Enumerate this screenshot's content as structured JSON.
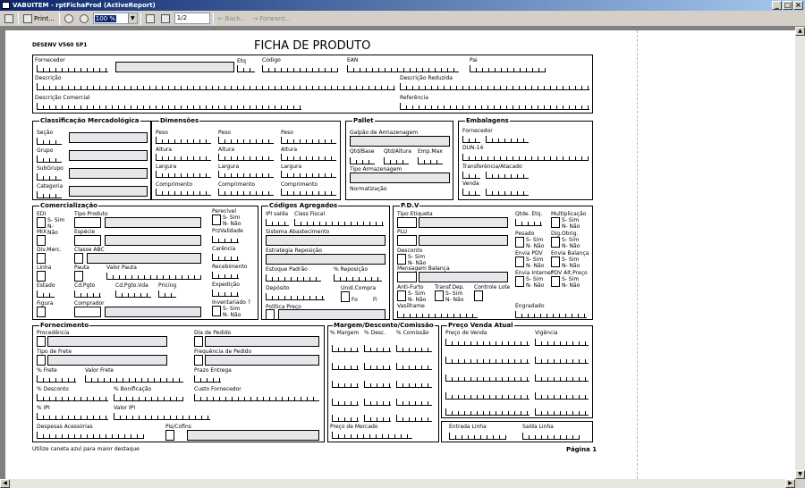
{
  "window": {
    "title": "VABUITEM - rptFichaProd (ActiveReport)",
    "min": "_",
    "max": "□",
    "close": "×"
  },
  "toolbar": {
    "print": "Print...",
    "zoom": "100 %",
    "page": "1/2",
    "back": "Back...",
    "forward": "Forward..."
  },
  "report": {
    "header_code": "DESENV V560 SP1",
    "title": "FICHA DE PRODUTO",
    "page": "Página 1",
    "footer_note": "Utilize caneta azul para maior destaque",
    "top": {
      "fornecedor": "Fornecedor",
      "etq": "Etq",
      "codigo": "Código",
      "ean": "EAN",
      "pai": "Pai",
      "descricao": "Descrição",
      "descricao_reduzida": "Descrição Reduzida",
      "descricao_comercial": "Descrição Comercial",
      "referencia": "Referência"
    },
    "classificacao": {
      "title": "Classificação Mercadológica",
      "secao": "Seção",
      "grupo": "Grupo",
      "subgrupo": "SubGrupo",
      "categoria": "Categoria"
    },
    "dimensoes": {
      "title": "Dimensões",
      "peso": "Peso",
      "altura": "Altura",
      "largura": "Largura",
      "comprimento": "Comprimento"
    },
    "pallet": {
      "title": "Pallet",
      "galpao": "Galpão de Armazenagem",
      "qtd_base": "Qtd/Base",
      "qtd_altura": "Qtd/Altura",
      "emp_max": "Emp.Max",
      "tipo_armazenagem": "Tipo Armazenagem",
      "normatizacao": "Normatização"
    },
    "embalagens": {
      "title": "Embalagens",
      "fornecedor": "Fornecedor",
      "dun": "DUN-14",
      "transferencia": "Transferência/Atacado",
      "venda": "Venda"
    },
    "comercializacao": {
      "title": "Comercialização",
      "edi": "EDI",
      "sim_nao": "S- Sim N- Não",
      "tipo_produto": "Tipo Produto",
      "mix": "MIX",
      "especie": "Espécie",
      "div_merc": "Div.Merc.",
      "classe_abc": "Classe ABC",
      "linha": "Linha",
      "pauta": "Pauta",
      "valor_pauta": "Valor Pauta",
      "estado": "Estado",
      "cd_pgto": "Cd.Pgto",
      "cd_pgto_vda": "Cd.Pgto.Vda",
      "pricing": "Pricing",
      "figura": "Figura",
      "comprador": "Comprador",
      "perecivel": "Perecível",
      "przvalidade": "PrzValidade",
      "carencia": "Carência",
      "recebimento": "Recebimento",
      "expedicao": "Expedição",
      "inventariado": "Inventariado ?"
    },
    "codigos": {
      "title": "Códigos Agregados",
      "ipi_saida": "IPI saída",
      "class_fiscal": "Class Fiscal",
      "sistema": "Sistema Abastecimento",
      "estrategia": "Estratégia Reposição",
      "estoque": "Estoque Padrão",
      "pct_reposicao": "% Reposição",
      "deposito": "Depósito",
      "unid_compra": "Unid.Compra",
      "fo": "Fo",
      "fi": "Fi",
      "politica": "Política Preço"
    },
    "pdv": {
      "title": "P.D.V",
      "tipo_etiqueta": "Tipo Etiqueta",
      "qtde_etq": "Qtde. Etq.",
      "multiplicacao": "Multiplicação",
      "plu": "PLU",
      "pesado": "Pesado",
      "dig_obrig": "Dig.Obrig.",
      "desconto": "Desconto",
      "envia_pdv": "Envia PDV",
      "envia_balanca": "Envia Balança",
      "mensagem_balanca": "Mensagem Balança",
      "envia_internet": "Envia Internet",
      "pdv_alt_preco": "PDV Alt.Preço",
      "anti_furto": "Anti-Furto",
      "transf_dep": "Transf.Dep.",
      "controle_lote": "Controle Lote",
      "vasilhame": "Vasilhame",
      "engradado": "Engradado"
    },
    "fornecimento": {
      "title": "Fornecimento",
      "procedencia": "Procedência",
      "dia_pedido": "Dia de Pedido",
      "tipo_frete": "Tipo de Frete",
      "frequencia": "Frequência de Pedido",
      "pct_frete": "% Frete",
      "valor_frete": "Valor Frete",
      "prazo_entrega": "Prazo Entrega",
      "pct_desconto": "% Desconto",
      "pct_bonificacao": "% Bonificação",
      "custo_fornecedor": "Custo Fornecedor",
      "pct_ipi": "% IPI",
      "valor_ipi": "Valor IPI",
      "despesas": "Despesas Acessórias",
      "pis_cofins": "Pis/Cofins"
    },
    "margem": {
      "title": "Margem/Desconto/Comissão",
      "pct_margem": "% Margem",
      "pct_desc": "% Desc.",
      "pct_comissao": "% Comissão",
      "preco_mercado": "Preço de Mercado"
    },
    "preco": {
      "title": "Preço Venda Atual",
      "preco_venda": "Preço de Venda",
      "vigencia": "Vigência",
      "entrada_linha": "Entrada Linha",
      "saida_linha": "Saída Linha"
    }
  }
}
